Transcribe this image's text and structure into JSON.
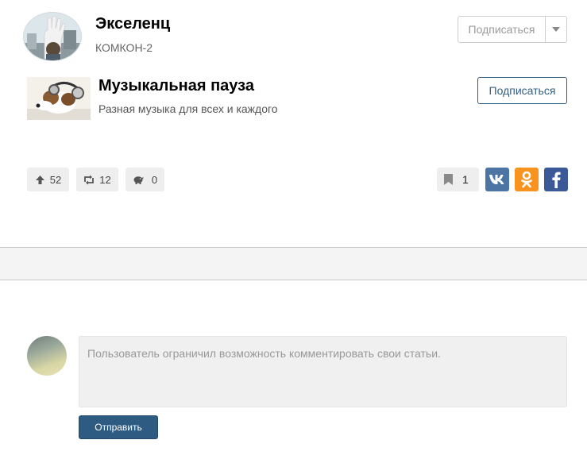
{
  "author": {
    "name": "Экселенц",
    "subtitle": "КОМКОН-2",
    "subscribe_label": "Подписаться"
  },
  "channel": {
    "title": "Музыкальная пауза",
    "description": "Разная музыка для всех и каждого",
    "subscribe_label": "Подписаться"
  },
  "actions": {
    "upvotes": "52",
    "reposts": "12",
    "donations": "0",
    "bookmarks": "1"
  },
  "share": [
    "vk-icon",
    "odnoklassniki-icon",
    "facebook-icon"
  ],
  "comments": {
    "disabled_message": "Пользователь ограничил возможность комментировать свои статьи.",
    "send_label": "Отправить"
  },
  "colors": {
    "accent": "#2e5b82",
    "vk": "#4c75a3",
    "odnoklassniki": "#f7931e",
    "facebook": "#3b5998"
  }
}
